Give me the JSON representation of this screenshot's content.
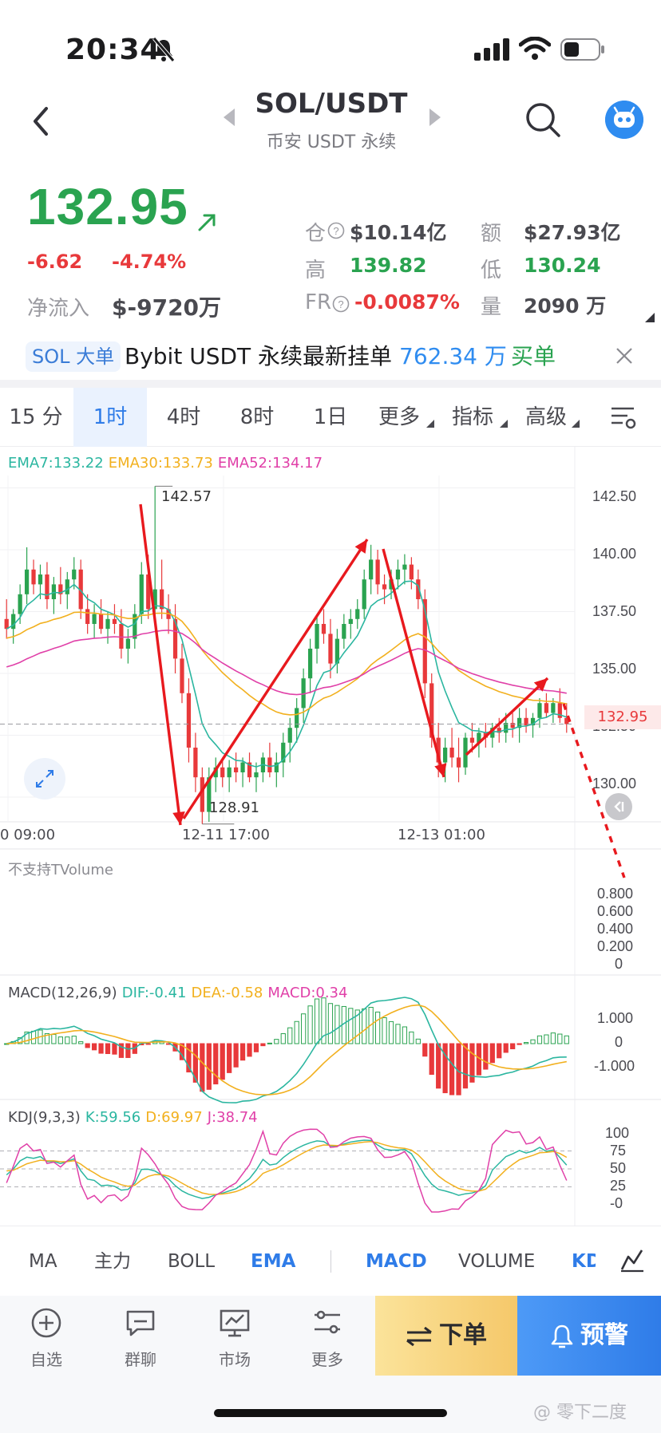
{
  "status_bar": {
    "time": "20:34"
  },
  "header": {
    "pair": "SOL/USDT",
    "exchange": "币安 USDT 永续"
  },
  "price": {
    "last": "132.95",
    "change_abs": "-6.62",
    "change_pct": "-4.74%",
    "netflow_label": "净流入",
    "netflow_value": "$-9720万"
  },
  "stats": {
    "oi_label": "仓",
    "oi_value": "$10.14亿",
    "turnover_label": "额",
    "turnover_value": "$27.93亿",
    "high_label": "高",
    "high_value": "139.82",
    "low_label": "低",
    "low_value": "130.24",
    "fr_label": "FR",
    "fr_value": "-0.0087%",
    "vol_label": "量",
    "vol_value": "2090 万"
  },
  "ticker": {
    "tag": "SOL 大单",
    "text": "Bybit USDT 永续最新挂单",
    "amount": "762.34 万",
    "side": "买单"
  },
  "tabs": [
    {
      "label": "15 分"
    },
    {
      "label": "1时"
    },
    {
      "label": "4时"
    },
    {
      "label": "8时"
    },
    {
      "label": "1日"
    },
    {
      "label": "更多"
    },
    {
      "label": "指标"
    },
    {
      "label": "高级"
    }
  ],
  "ema_legend": {
    "ema7": "EMA7:133.22",
    "ema30": "EMA30:133.73",
    "ema52": "EMA52:134.17"
  },
  "colors": {
    "up": "#2aa350",
    "down": "#e8393b",
    "accent": "#2f7ce8",
    "ema7": "#2bb6a0",
    "ema30": "#f2b01e",
    "ema52": "#e040a8"
  },
  "chart_data": {
    "type": "candlestick",
    "price_axis": [
      "142.50",
      "140.00",
      "137.50",
      "135.00",
      "132.50",
      "130.00"
    ],
    "ylim": [
      129.0,
      143.0
    ],
    "x_ticks": [
      "0 09:00",
      "12-11 17:00",
      "12-13 01:00"
    ],
    "current_price": "132.95",
    "high_marker": "142.57",
    "low_marker": "128.91",
    "candles": [
      [
        137.2,
        138.0,
        136.4,
        136.8
      ],
      [
        136.8,
        137.6,
        136.2,
        137.4
      ],
      [
        137.4,
        138.6,
        137.0,
        138.2
      ],
      [
        138.2,
        140.1,
        137.8,
        139.2
      ],
      [
        139.2,
        139.6,
        138.2,
        138.6
      ],
      [
        138.6,
        139.4,
        138.0,
        139.0
      ],
      [
        139.0,
        139.5,
        137.6,
        138.0
      ],
      [
        138.0,
        138.9,
        137.4,
        138.6
      ],
      [
        138.6,
        139.3,
        137.8,
        138.2
      ],
      [
        138.2,
        139.1,
        137.6,
        138.8
      ],
      [
        138.8,
        139.7,
        138.4,
        139.2
      ],
      [
        139.2,
        139.6,
        137.2,
        137.6
      ],
      [
        137.6,
        138.2,
        136.6,
        137.0
      ],
      [
        137.0,
        137.8,
        136.4,
        137.4
      ],
      [
        137.4,
        138.0,
        136.6,
        136.8
      ],
      [
        136.8,
        137.5,
        136.2,
        137.2
      ],
      [
        137.2,
        137.8,
        136.6,
        137.0
      ],
      [
        137.0,
        137.6,
        135.6,
        136.0
      ],
      [
        136.0,
        136.8,
        135.4,
        136.4
      ],
      [
        136.4,
        137.8,
        136.0,
        137.4
      ],
      [
        137.4,
        139.5,
        137.0,
        139.0
      ],
      [
        139.0,
        139.8,
        137.2,
        137.6
      ],
      [
        137.6,
        142.57,
        137.2,
        138.4
      ],
      [
        138.4,
        139.6,
        137.2,
        137.6
      ],
      [
        137.6,
        138.2,
        136.6,
        137.2
      ],
      [
        137.2,
        137.8,
        135.0,
        135.6
      ],
      [
        135.6,
        136.2,
        133.8,
        134.2
      ],
      [
        134.2,
        134.8,
        131.4,
        132.0
      ],
      [
        132.0,
        132.6,
        130.2,
        130.8
      ],
      [
        130.8,
        131.2,
        128.91,
        129.4
      ],
      [
        129.4,
        131.2,
        129.0,
        130.8
      ],
      [
        130.8,
        131.6,
        130.2,
        131.2
      ],
      [
        131.2,
        131.6,
        130.4,
        130.8
      ],
      [
        130.8,
        131.5,
        130.2,
        131.2
      ],
      [
        131.2,
        131.8,
        130.6,
        131.0
      ],
      [
        131.0,
        131.6,
        130.4,
        131.4
      ],
      [
        131.4,
        131.8,
        130.6,
        130.8
      ],
      [
        130.8,
        131.4,
        130.2,
        131.0
      ],
      [
        131.0,
        131.8,
        130.6,
        131.6
      ],
      [
        131.6,
        132.2,
        130.8,
        131.0
      ],
      [
        131.0,
        131.8,
        130.4,
        131.4
      ],
      [
        131.4,
        132.6,
        130.8,
        132.2
      ],
      [
        132.2,
        133.2,
        131.4,
        132.8
      ],
      [
        132.8,
        134.0,
        132.2,
        133.6
      ],
      [
        133.6,
        135.2,
        133.0,
        134.8
      ],
      [
        134.8,
        136.4,
        134.2,
        136.0
      ],
      [
        136.0,
        137.4,
        135.4,
        137.0
      ],
      [
        137.0,
        137.6,
        136.2,
        136.6
      ],
      [
        136.6,
        137.2,
        134.8,
        135.4
      ],
      [
        135.4,
        136.8,
        135.0,
        136.4
      ],
      [
        136.4,
        137.4,
        136.0,
        137.0
      ],
      [
        137.0,
        137.6,
        136.4,
        137.2
      ],
      [
        137.2,
        138.0,
        136.8,
        137.6
      ],
      [
        137.6,
        139.2,
        137.2,
        138.8
      ],
      [
        138.8,
        140.2,
        138.2,
        139.6
      ],
      [
        139.6,
        140.0,
        138.2,
        138.6
      ],
      [
        138.6,
        139.0,
        137.8,
        138.4
      ],
      [
        138.4,
        139.2,
        138.0,
        138.8
      ],
      [
        138.8,
        139.6,
        138.4,
        139.2
      ],
      [
        139.2,
        139.82,
        138.6,
        139.4
      ],
      [
        139.4,
        139.7,
        138.4,
        138.8
      ],
      [
        138.8,
        139.2,
        137.6,
        138.0
      ],
      [
        138.0,
        138.4,
        134.0,
        134.6
      ],
      [
        134.6,
        135.0,
        132.0,
        132.4
      ],
      [
        132.4,
        133.0,
        130.8,
        131.4
      ],
      [
        131.4,
        132.4,
        130.6,
        132.0
      ],
      [
        132.0,
        132.8,
        131.2,
        131.6
      ],
      [
        131.6,
        132.4,
        130.6,
        131.2
      ],
      [
        131.2,
        132.6,
        130.9,
        132.4
      ],
      [
        132.4,
        133.0,
        131.8,
        132.2
      ],
      [
        132.2,
        132.8,
        131.6,
        132.6
      ],
      [
        132.6,
        133.0,
        132.0,
        132.4
      ],
      [
        132.4,
        133.0,
        132.0,
        132.8
      ],
      [
        132.8,
        133.2,
        132.2,
        132.6
      ],
      [
        132.6,
        133.4,
        132.2,
        133.0
      ],
      [
        133.0,
        133.4,
        132.4,
        132.8
      ],
      [
        132.8,
        133.6,
        132.2,
        133.2
      ],
      [
        133.2,
        133.6,
        132.6,
        132.9
      ],
      [
        132.9,
        133.4,
        132.4,
        133.2
      ],
      [
        133.2,
        134.0,
        132.8,
        133.8
      ],
      [
        133.8,
        134.2,
        133.2,
        133.4
      ],
      [
        133.4,
        134.0,
        133.0,
        133.8
      ],
      [
        133.8,
        134.4,
        133.0,
        133.2
      ],
      [
        133.2,
        133.8,
        132.6,
        132.95
      ]
    ]
  },
  "tvolume": {
    "label": "不支持TVolume",
    "ticks": [
      "0.800",
      "0.600",
      "0.400",
      "0.200",
      "0"
    ]
  },
  "macd": {
    "name": "MACD(12,26,9)",
    "dif": "DIF:-0.41",
    "dea": "DEA:-0.58",
    "macd": "MACD:0.34",
    "ticks": [
      "1.000",
      "0",
      "-1.000"
    ]
  },
  "kdj": {
    "name": "KDJ(9,3,3)",
    "k": "K:59.56",
    "d": "D:69.97",
    "j": "J:38.74",
    "ticks": [
      "100",
      "75",
      "50",
      "25",
      "-0"
    ]
  },
  "indicators": [
    {
      "label": "MA"
    },
    {
      "label": "主力"
    },
    {
      "label": "BOLL"
    },
    {
      "label": "EMA"
    },
    {
      "label": "MACD"
    },
    {
      "label": "VOLUME"
    },
    {
      "label": "KD"
    }
  ],
  "bottom_nav": {
    "watchlist": "自选",
    "chat": "群聊",
    "market": "市场",
    "more": "更多",
    "order": "下单",
    "alert": "预警"
  },
  "watermark": "@ 零下二度"
}
